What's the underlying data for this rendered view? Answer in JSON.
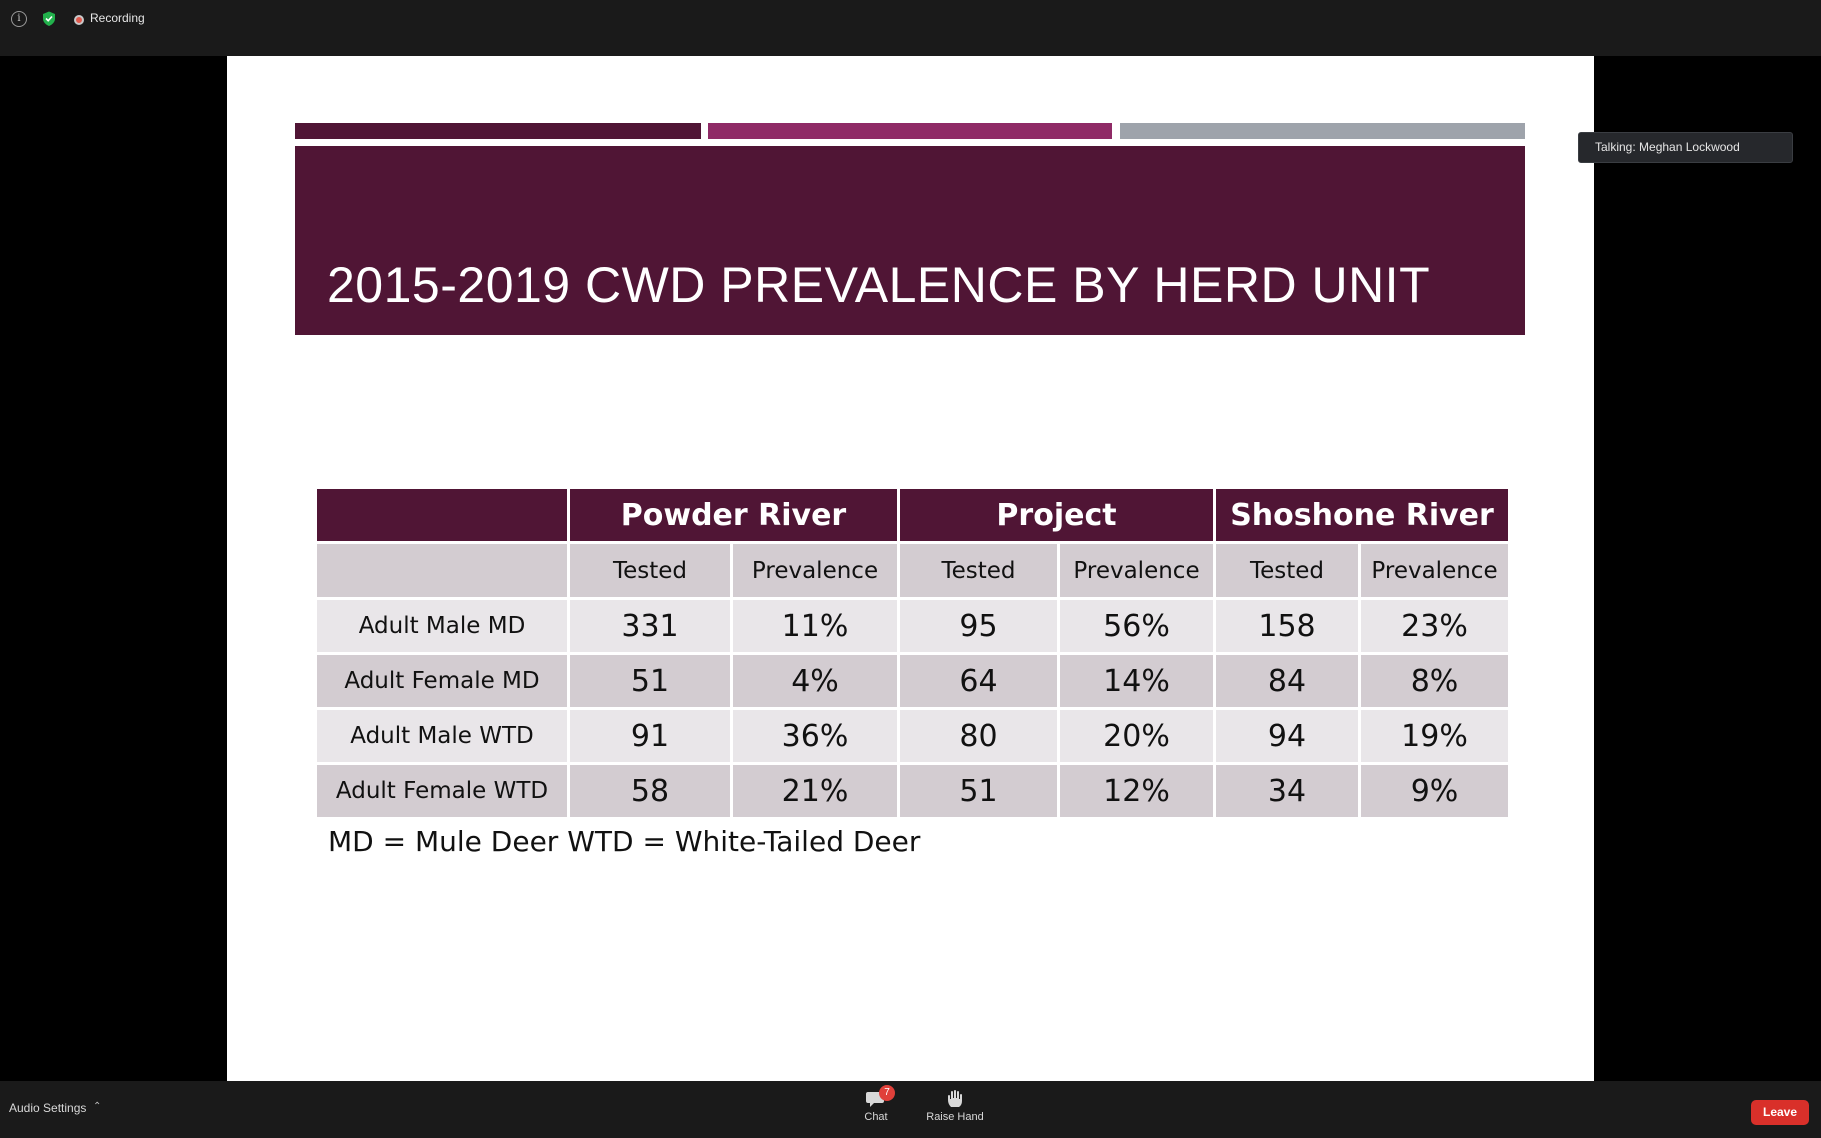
{
  "topbar": {
    "recording_label": "Recording"
  },
  "slide": {
    "title": "2015-2019 CWD PREVALENCE BY HERD UNIT",
    "colors": {
      "bar1": "#501535",
      "bar2": "#8f2a66",
      "bar3": "#9ea3ab",
      "header_bg": "#501535"
    },
    "table": {
      "groups": [
        "Powder River",
        "Project",
        "Shoshone River"
      ],
      "subheaders": [
        "Tested",
        "Prevalence",
        "Tested",
        "Prevalence",
        "Tested",
        "Prevalence"
      ],
      "rows": [
        {
          "label": "Adult Male MD",
          "cells": [
            "331",
            "11%",
            "95",
            "56%",
            "158",
            "23%"
          ]
        },
        {
          "label": "Adult Female MD",
          "cells": [
            "51",
            "4%",
            "64",
            "14%",
            "84",
            "8%"
          ]
        },
        {
          "label": "Adult Male WTD",
          "cells": [
            "91",
            "36%",
            "80",
            "20%",
            "94",
            "19%"
          ]
        },
        {
          "label": "Adult Female WTD",
          "cells": [
            "58",
            "21%",
            "51",
            "12%",
            "34",
            "9%"
          ]
        }
      ]
    },
    "footnote": "MD = Mule Deer  WTD = White-Tailed Deer"
  },
  "talking_indicator": "Talking: Meghan Lockwood",
  "bottombar": {
    "audio_settings": "Audio Settings",
    "chat_label": "Chat",
    "chat_badge": "7",
    "raise_hand_label": "Raise Hand",
    "leave_label": "Leave"
  }
}
